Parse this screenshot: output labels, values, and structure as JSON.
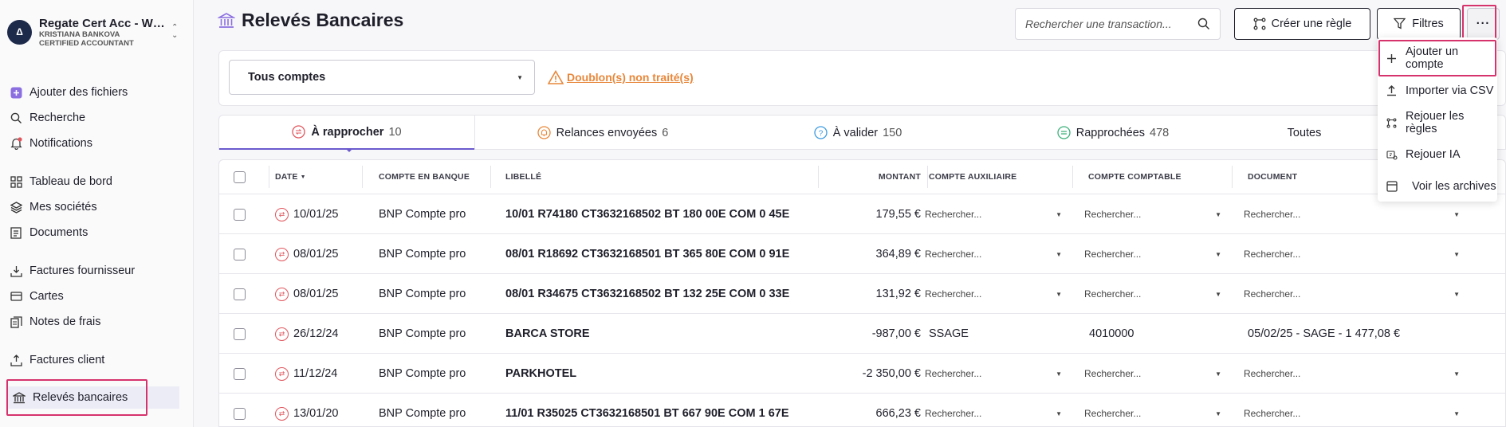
{
  "org": {
    "name": "Regate Cert Acc - With...",
    "user": "KRISTIANA BANKOVA",
    "role": "CERTIFIED ACCOUNTANT",
    "logo_letter": "Δ"
  },
  "sidebar": {
    "items": [
      {
        "label": "Ajouter des fichiers",
        "icon": "plus-square-icon"
      },
      {
        "label": "Recherche",
        "icon": "search-icon"
      },
      {
        "label": "Notifications",
        "icon": "bell-icon"
      },
      {
        "label": "Tableau de bord",
        "icon": "grid-icon"
      },
      {
        "label": "Mes sociétés",
        "icon": "layers-icon"
      },
      {
        "label": "Documents",
        "icon": "document-icon"
      },
      {
        "label": "Factures fournisseur",
        "icon": "download-tray-icon"
      },
      {
        "label": "Cartes",
        "icon": "card-icon"
      },
      {
        "label": "Notes de frais",
        "icon": "receipt-icon"
      },
      {
        "label": "Factures client",
        "icon": "upload-tray-icon"
      },
      {
        "label": "Relevés bancaires",
        "icon": "bank-icon",
        "active": true
      }
    ]
  },
  "header": {
    "title": "Relevés Bancaires",
    "search_placeholder": "Rechercher une transaction...",
    "create_rule_label": "Créer une règle",
    "filters_label": "Filtres",
    "more_label": "···"
  },
  "filter": {
    "account_select": "Tous comptes",
    "duplicates_link": "Doublon(s) non traité(s)"
  },
  "tabs": [
    {
      "label": "À rapprocher",
      "count": "10",
      "active": true,
      "color": "#e0555c"
    },
    {
      "label": "Relances envoyées",
      "count": "6",
      "color": "#e8873a"
    },
    {
      "label": "À valider",
      "count": "150",
      "color": "#3b9ae1"
    },
    {
      "label": "Rapprochées",
      "count": "478",
      "color": "#3bb07a"
    },
    {
      "label": "Toutes",
      "count": ""
    }
  ],
  "table": {
    "headers": {
      "date": "DATE",
      "bank_account": "COMPTE EN BANQUE",
      "label": "LIBELLÉ",
      "amount": "MONTANT",
      "aux_account": "COMPTE AUXILIAIRE",
      "gl_account": "COMPTE COMPTABLE",
      "document": "DOCUMENT"
    },
    "search_placeholder": "Rechercher...",
    "rows": [
      {
        "date": "10/01/25",
        "bank": "BNP Compte pro",
        "label": "10/01 R74180 CT3632168502 BT 180 00E COM 0 45E",
        "amount": "179,55 €",
        "aux": "",
        "gl": "",
        "doc": ""
      },
      {
        "date": "08/01/25",
        "bank": "BNP Compte pro",
        "label": "08/01 R18692 CT3632168501 BT 365 80E COM 0 91E",
        "amount": "364,89 €",
        "aux": "",
        "gl": "",
        "doc": ""
      },
      {
        "date": "08/01/25",
        "bank": "BNP Compte pro",
        "label": "08/01 R34675 CT3632168502 BT 132 25E COM 0 33E",
        "amount": "131,92 €",
        "aux": "",
        "gl": "",
        "doc": ""
      },
      {
        "date": "26/12/24",
        "bank": "BNP Compte pro",
        "label": "BARCA STORE",
        "amount": "-987,00 €",
        "aux": "SSAGE",
        "gl": "4010000",
        "doc": "05/02/25 - SAGE - 1 477,08 €"
      },
      {
        "date": "11/12/24",
        "bank": "BNP Compte pro",
        "label": "PARKHOTEL",
        "amount": "-2 350,00 €",
        "aux": "",
        "gl": "",
        "doc": ""
      },
      {
        "date": "13/01/20",
        "bank": "BNP Compte pro",
        "label": "11/01 R35025 CT3632168501 BT 667 90E COM 1 67E",
        "amount": "666,23 €",
        "aux": "",
        "gl": "",
        "doc": ""
      }
    ]
  },
  "menu": {
    "items": [
      {
        "label": "Ajouter un compte",
        "icon": "plus-icon"
      },
      {
        "label": "Importer via CSV",
        "icon": "upload-icon"
      },
      {
        "label": "Rejouer les règles",
        "icon": "rules-icon"
      },
      {
        "label": "Rejouer IA",
        "icon": "ai-icon"
      },
      {
        "label": "Voir les archives",
        "icon": "archive-icon"
      }
    ]
  },
  "colors": {
    "accent": "#6a5acd",
    "highlight": "#d6336c",
    "warning": "#e8873a",
    "status_red": "#e0555c"
  }
}
